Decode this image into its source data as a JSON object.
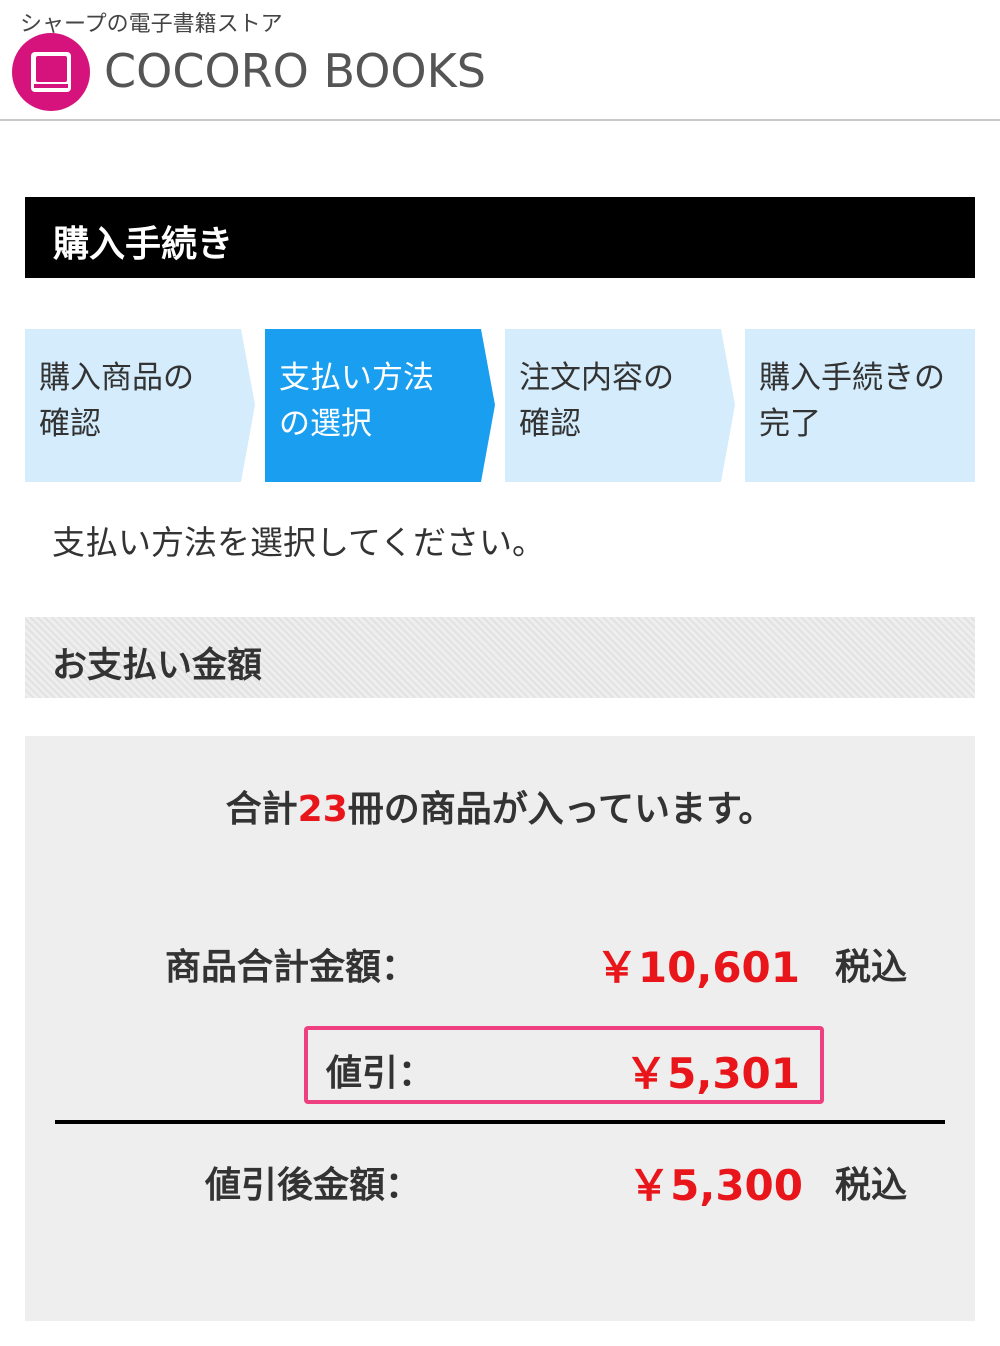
{
  "header": {
    "tagline": "シャープの電子書籍ストア",
    "brand": "COCORO BOOKS",
    "logo_icon": "book-icon",
    "brand_color": "#d6137d"
  },
  "page_title": "購入手続き",
  "steps": [
    {
      "label": "購入商品の\n確認",
      "active": false
    },
    {
      "label": "支払い方法\nの選択",
      "active": true
    },
    {
      "label": "注文内容の\n確認",
      "active": false
    },
    {
      "label": "購入手続きの\n完了",
      "active": false
    }
  ],
  "instruction": "支払い方法を選択してください。",
  "section_title": "お支払い金額",
  "summary": {
    "line_prefix": "合計",
    "count": "23",
    "line_suffix": "冊の商品が入っています。",
    "subtotal_label": "商品合計金額：",
    "subtotal_amount": "￥10,601",
    "subtotal_tax": "税込",
    "discount_label": "値引：",
    "discount_amount": "￥5,301",
    "total_label": "値引後金額：",
    "total_amount": "￥5,300",
    "total_tax": "税込"
  },
  "colors": {
    "step_active": "#1a9ef0",
    "step_inactive": "#d4ecfb",
    "price_red": "#e8161b",
    "highlight_pink": "#ee3f80"
  }
}
